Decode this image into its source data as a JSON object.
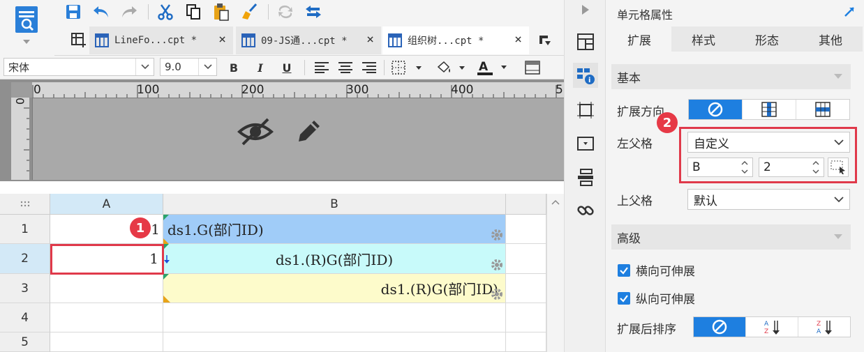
{
  "tabs": [
    {
      "label": "LineFo...cpt *",
      "close": "×"
    },
    {
      "label": "09-JS通...cpt *",
      "close": "×"
    },
    {
      "label": "组织树...cpt *",
      "close": "×"
    }
  ],
  "format_toolbar": {
    "font_family": "宋体",
    "font_size": "9.0",
    "bold": "B",
    "italic": "I",
    "underline": "U"
  },
  "ruler": {
    "h_ticks": [
      "0",
      "100",
      "200",
      "300",
      "400",
      "5"
    ],
    "v_tick": "0"
  },
  "grid": {
    "columns": [
      "A",
      "B"
    ],
    "rows": [
      "1",
      "2",
      "3",
      "4",
      "5"
    ],
    "cells": {
      "a1": "1",
      "b1": "ds1.G(部门ID)",
      "a2": "1",
      "b2": "ds1.(R)G(部门ID)",
      "b3": "ds1.(R)G(部门ID)"
    }
  },
  "panel": {
    "title": "单元格属性",
    "tabs": [
      "扩展",
      "样式",
      "形态",
      "其他"
    ],
    "basic_section": "基本",
    "expand_direction_label": "扩展方向",
    "left_parent_label": "左父格",
    "left_parent_value": "自定义",
    "left_parent_col": "B",
    "left_parent_row": "2",
    "upper_parent_label": "上父格",
    "upper_parent_value": "默认",
    "advanced_section": "高级",
    "horizontal_extensible": "横向可伸展",
    "vertical_extensible": "纵向可伸展",
    "sort_after_expand_label": "扩展后排序"
  },
  "annotations": {
    "badge1": "1",
    "badge2": "2"
  },
  "colors": {
    "accent": "#1e7fe0",
    "annotation_red": "#e0394a",
    "cell_blue": "#a0ccf8",
    "cell_cyan": "#c8fafa",
    "cell_yellow": "#fdfbcb"
  }
}
